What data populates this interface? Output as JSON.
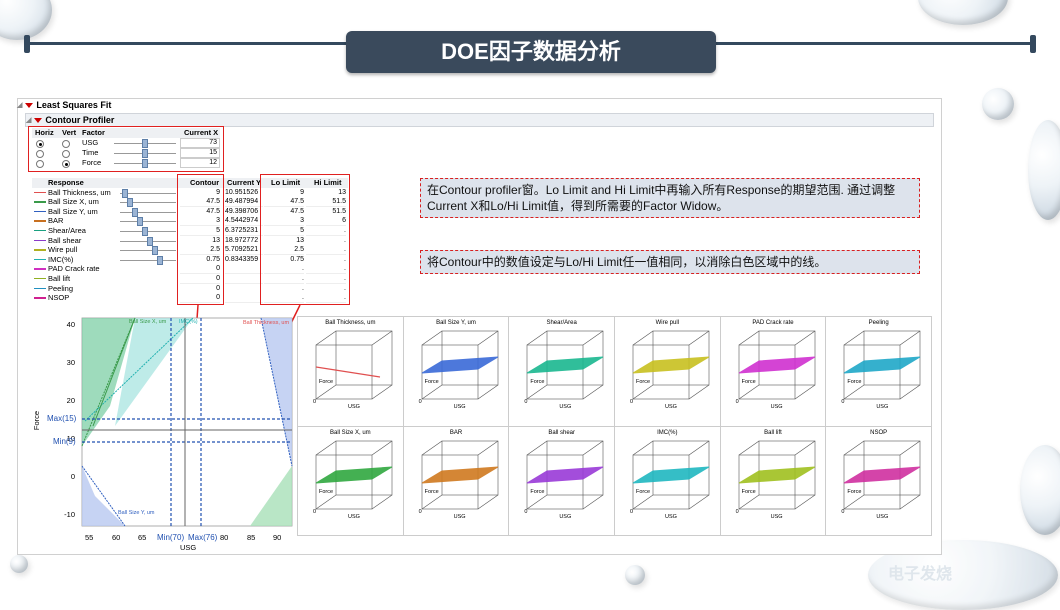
{
  "slide_title": "DOE因子数据分析",
  "sections": {
    "least_squares": "Least Squares Fit",
    "contour_profiler": "Contour Profiler"
  },
  "factor_table": {
    "headers": [
      "Horiz",
      "Vert",
      "Factor",
      "Current X"
    ],
    "rows": [
      {
        "factor": "USG",
        "current_x": "73",
        "horiz": true,
        "vert": false
      },
      {
        "factor": "Time",
        "current_x": "15",
        "horiz": false,
        "vert": false
      },
      {
        "factor": "Force",
        "current_x": "12",
        "horiz": false,
        "vert": true
      }
    ]
  },
  "response_table": {
    "headers": [
      "Response",
      "Contour",
      "Current Y",
      "Lo Limit",
      "Hi Limit"
    ],
    "rows": [
      {
        "name": "Ball Thickness, um",
        "color": "#e05050",
        "contour": "9",
        "current_y": "10.951526",
        "lo": "9",
        "hi": "13"
      },
      {
        "name": "Ball Size X, um",
        "color": "#3a9a4a",
        "contour": "47.5",
        "current_y": "49.487994",
        "lo": "47.5",
        "hi": "51.5"
      },
      {
        "name": "Ball Size Y, um",
        "color": "#3060c0",
        "contour": "47.5",
        "current_y": "49.398706",
        "lo": "47.5",
        "hi": "51.5"
      },
      {
        "name": "BAR",
        "color": "#c87020",
        "contour": "3",
        "current_y": "4.5442974",
        "lo": "3",
        "hi": "6"
      },
      {
        "name": "Shear/Area",
        "color": "#1aa080",
        "contour": "5",
        "current_y": "6.3725231",
        "lo": "5",
        "hi": "."
      },
      {
        "name": "Ball shear",
        "color": "#8a3ac8",
        "contour": "13",
        "current_y": "18.972772",
        "lo": "13",
        "hi": "."
      },
      {
        "name": "Wire pull",
        "color": "#b0b020",
        "contour": "2.5",
        "current_y": "5.7092521",
        "lo": "2.5",
        "hi": "."
      },
      {
        "name": "IMC(%)",
        "color": "#20b0b0",
        "contour": "0.75",
        "current_y": "0.8343359",
        "lo": "0.75",
        "hi": "."
      },
      {
        "name": "PAD Crack rate",
        "color": "#d030c0",
        "contour": "0",
        "current_y": "",
        "lo": ".",
        "hi": "."
      },
      {
        "name": "Ball lift",
        "color": "#90b020",
        "contour": "0",
        "current_y": "",
        "lo": ".",
        "hi": "."
      },
      {
        "name": "Peeling",
        "color": "#2090c0",
        "contour": "0",
        "current_y": "",
        "lo": ".",
        "hi": "."
      },
      {
        "name": "NSOP",
        "color": "#d02090",
        "contour": "0",
        "current_y": "",
        "lo": ".",
        "hi": "."
      }
    ]
  },
  "callouts": {
    "first": "在Contour profiler窗。Lo Limit and Hi Limit中再输入所有Response的期望范围. 通过调整Current X和Lo/Hi Limit值，得到所需要的Factor Widow。",
    "second": "将Contour中的数值设定与Lo/Hi Limit任一值相同，以消除白色区域中的线。"
  },
  "contour_plot": {
    "ylabel": "Force",
    "xlabel": "USG",
    "y_ticks": [
      "40",
      "30",
      "20",
      "10",
      "0",
      "-10"
    ],
    "x_ticks": [
      "55",
      "60",
      "65",
      "70",
      "75",
      "80",
      "85",
      "90"
    ],
    "marker_labels": {
      "max_force": "Max(15)",
      "min_force": "Min(9)",
      "min_usg": "Min(70)",
      "max_usg": "Max(76)"
    },
    "region_labels": {
      "ball_size_x": "Ball Size X, um",
      "imc": "IMC(%)",
      "ball_thickness": "Ball Thickness, um",
      "ball_size_y": "Ball Size Y, um"
    }
  },
  "surface_plots": [
    {
      "title": "Ball Thickness, um",
      "color": "#e05050",
      "type": "line"
    },
    {
      "title": "Ball Size Y, um",
      "color": "#3a6ad8"
    },
    {
      "title": "Shear/Area",
      "color": "#1ab890"
    },
    {
      "title": "Wire pull",
      "color": "#c8c020"
    },
    {
      "title": "PAD Crack rate",
      "color": "#d030d0"
    },
    {
      "title": "Peeling",
      "color": "#20a8c8"
    },
    {
      "title": "Ball Size X, um",
      "color": "#30a840"
    },
    {
      "title": "BAR",
      "color": "#d07a20"
    },
    {
      "title": "Ball shear",
      "color": "#9a3ad8"
    },
    {
      "title": "IMC(%)",
      "color": "#20b8c0"
    },
    {
      "title": "Ball lift",
      "color": "#a0c020"
    },
    {
      "title": "NSOP",
      "color": "#d030a0"
    }
  ],
  "surface_axis": {
    "force": "Force",
    "usg": "USG",
    "zero": "0"
  },
  "watermark": "电子发烧"
}
